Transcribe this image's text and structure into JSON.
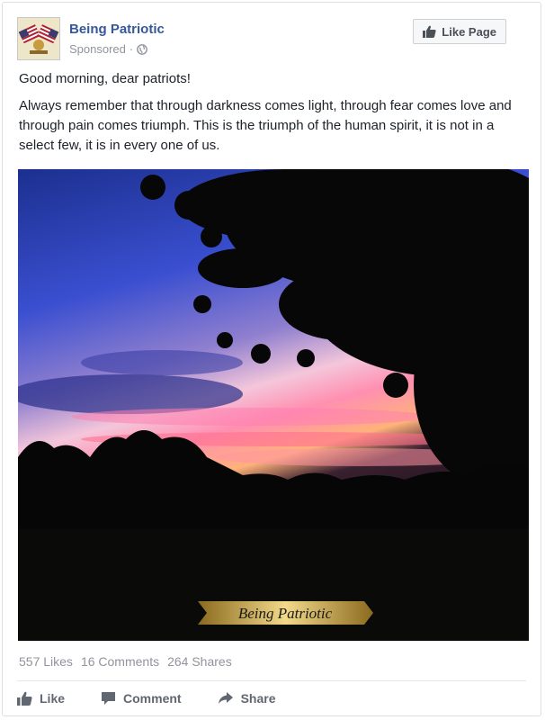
{
  "post": {
    "page_name": "Being Patriotic",
    "sponsored": "Sponsored",
    "separator": "·",
    "like_page_label": "Like Page",
    "greeting": "Good morning, dear patriots!",
    "body": "Always remember that through darkness comes light, through fear comes love and through pain comes triumph. This is the triumph of the human spirit, it is not in a select few, it is in every one of us.",
    "image_watermark": "Being Patriotic"
  },
  "stats": {
    "likes": "557 Likes",
    "comments": "16 Comments",
    "shares": "264 Shares"
  },
  "actions": {
    "like": "Like",
    "comment": "Comment",
    "share": "Share"
  },
  "colors": {
    "link_blue": "#365899",
    "muted_gray": "#90949c",
    "action_gray": "#616770"
  },
  "icons": [
    "globe-icon",
    "thumbs-up-icon",
    "comment-icon",
    "share-icon"
  ]
}
